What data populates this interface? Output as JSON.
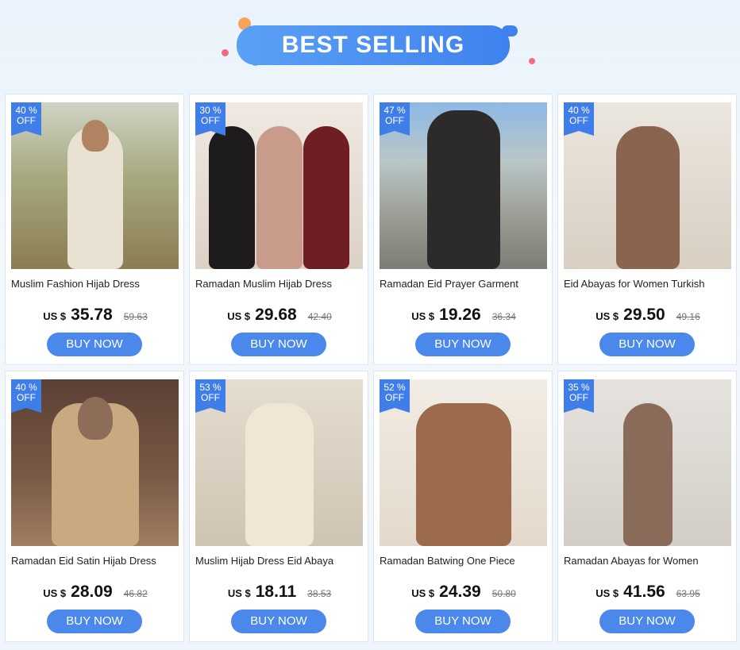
{
  "header": {
    "title": "BEST SELLING"
  },
  "products": [
    {
      "badge_pct": "40 %",
      "badge_off": "OFF",
      "title": "Muslim Fashion Hijab Dress",
      "currency": "US $",
      "price": "35.78",
      "old_price": "59.63",
      "buy_label": "BUY NOW"
    },
    {
      "badge_pct": "30 %",
      "badge_off": "OFF",
      "title": "Ramadan Muslim Hijab Dress",
      "currency": "US $",
      "price": "29.68",
      "old_price": "42.40",
      "buy_label": "BUY NOW"
    },
    {
      "badge_pct": "47 %",
      "badge_off": "OFF",
      "title": "Ramadan Eid Prayer Garment",
      "currency": "US $",
      "price": "19.26",
      "old_price": "36.34",
      "buy_label": "BUY NOW"
    },
    {
      "badge_pct": "40 %",
      "badge_off": "OFF",
      "title": "Eid Abayas for Women Turkish",
      "currency": "US $",
      "price": "29.50",
      "old_price": "49.16",
      "buy_label": "BUY NOW"
    },
    {
      "badge_pct": "40 %",
      "badge_off": "OFF",
      "title": "Ramadan Eid Satin Hijab Dress",
      "currency": "US $",
      "price": "28.09",
      "old_price": "46.82",
      "buy_label": "BUY NOW"
    },
    {
      "badge_pct": "53 %",
      "badge_off": "OFF",
      "title": "Muslim Hijab Dress Eid Abaya",
      "currency": "US $",
      "price": "18.11",
      "old_price": "38.53",
      "buy_label": "BUY NOW"
    },
    {
      "badge_pct": "52 %",
      "badge_off": "OFF",
      "title": "Ramadan Batwing One Piece",
      "currency": "US $",
      "price": "24.39",
      "old_price": "50.80",
      "buy_label": "BUY NOW"
    },
    {
      "badge_pct": "35 %",
      "badge_off": "OFF",
      "title": "Ramadan Abayas for Women",
      "currency": "US $",
      "price": "41.56",
      "old_price": "63.95",
      "buy_label": "BUY NOW"
    }
  ],
  "colors": {
    "accent": "#4b88ec",
    "badge": "#3f7ee8"
  }
}
